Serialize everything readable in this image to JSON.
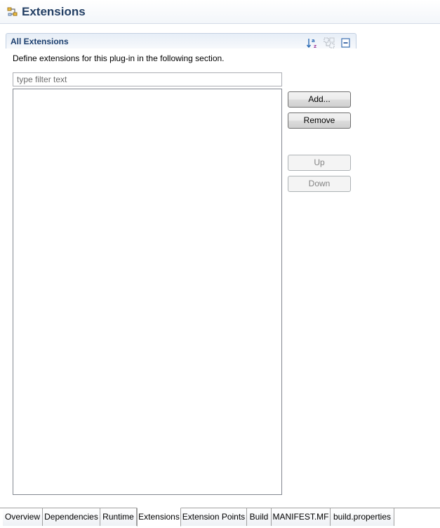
{
  "header": {
    "title": "Extensions",
    "icon": "extensions-icon"
  },
  "section": {
    "title": "All Extensions",
    "description": "Define extensions for this plug-in in the following section.",
    "toolbar": {
      "sort_icon": "sort-alphabetically-icon",
      "filter_icon": "filter-related-icon",
      "collapse_icon": "collapse-all-icon"
    }
  },
  "filter": {
    "placeholder": "type filter text",
    "value": ""
  },
  "buttons": {
    "add": "Add...",
    "remove": "Remove",
    "up": "Up",
    "down": "Down"
  },
  "tabs": [
    {
      "label": "Overview",
      "active": false
    },
    {
      "label": "Dependencies",
      "active": false
    },
    {
      "label": "Runtime",
      "active": false
    },
    {
      "label": "Extensions",
      "active": true
    },
    {
      "label": "Extension Points",
      "active": false
    },
    {
      "label": "Build",
      "active": false
    },
    {
      "label": "MANIFEST.MF",
      "active": false
    },
    {
      "label": "build.properties",
      "active": false
    }
  ],
  "colors": {
    "title": "#233f64",
    "section_title": "#1b3e6e",
    "disabled_text": "#838383"
  }
}
